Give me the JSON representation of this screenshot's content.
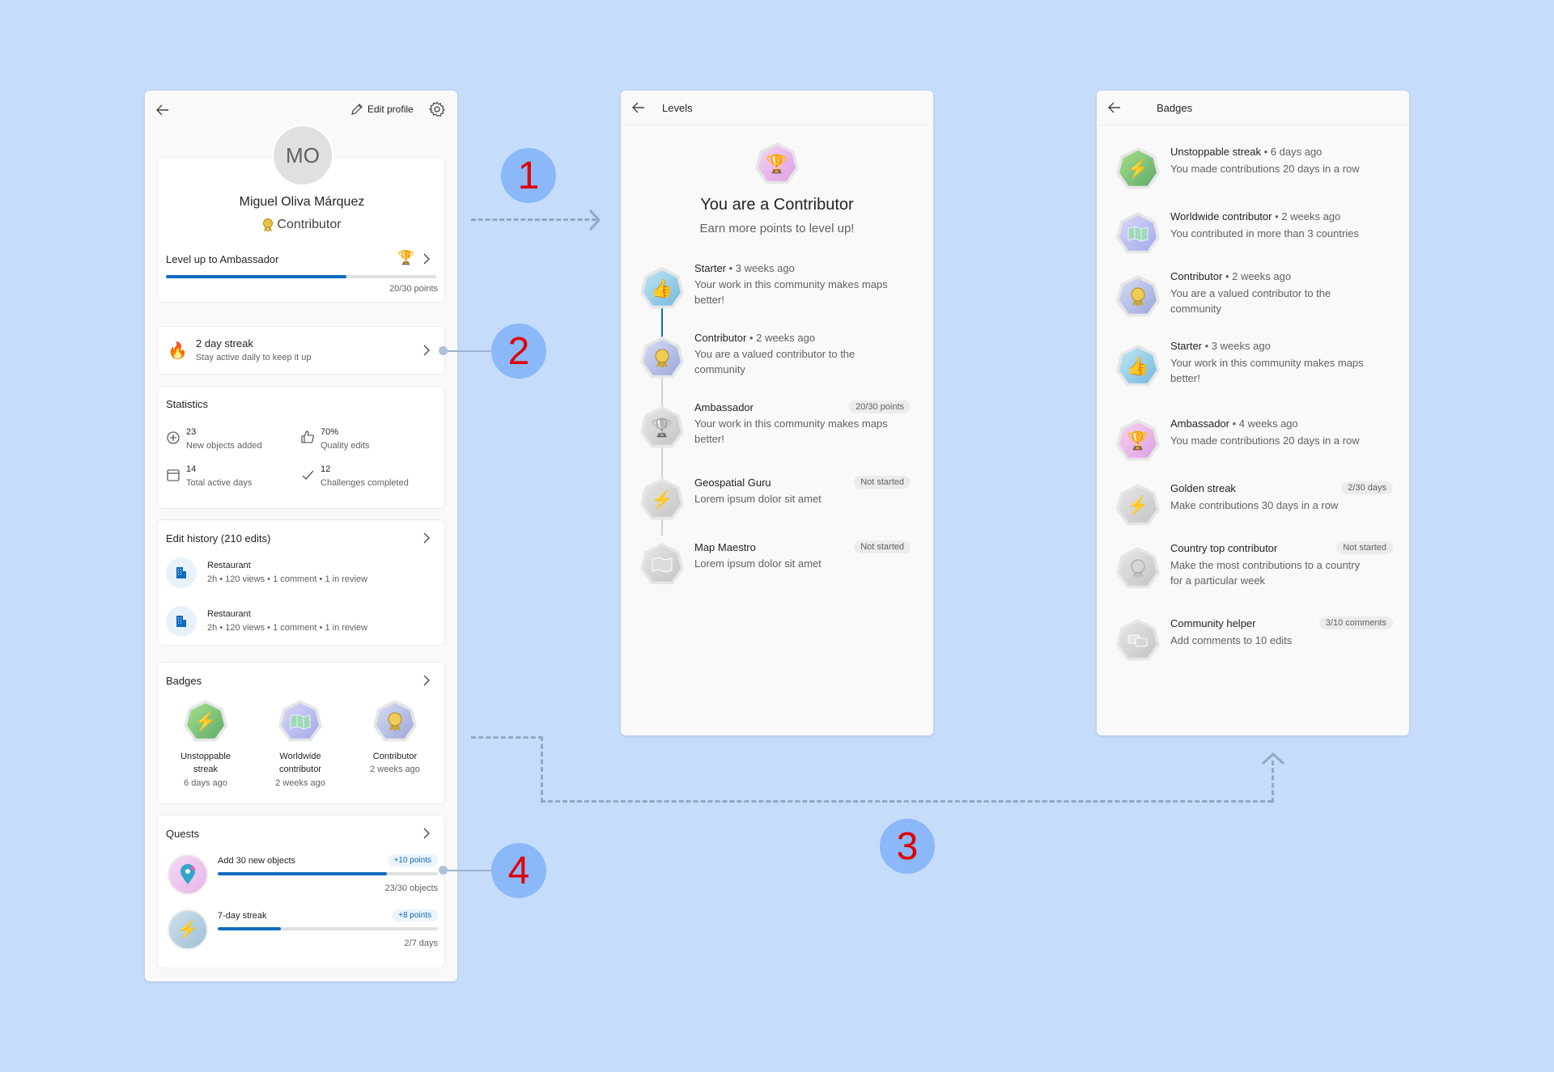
{
  "profile": {
    "edit_label": "Edit profile",
    "avatar_initials": "MO",
    "name": "Miguel Oliva Márquez",
    "level": "Contributor",
    "level_up_title": "Level up to Ambassador",
    "level_up_progress": 0.667,
    "level_up_points": "20/30 points",
    "streak_title": "2 day streak",
    "streak_sub": "Stay active daily to keep it up",
    "stats_title": "Statistics",
    "stats": [
      {
        "value": "23",
        "label": "New objects added",
        "icon": "plus-circle-icon"
      },
      {
        "value": "70%",
        "label": "Quality edits",
        "icon": "thumbs-up-icon"
      },
      {
        "value": "14",
        "label": "Total active days",
        "icon": "calendar-icon"
      },
      {
        "value": "12",
        "label": "Challenges completed",
        "icon": "checkmark-icon"
      }
    ],
    "history_title": "Edit history (210 edits)",
    "history": [
      {
        "title": "Restaurant",
        "meta": "2h • 120 views • 1 comment • 1 in review"
      },
      {
        "title": "Restaurant",
        "meta": "2h • 120 views • 1 comment • 1 in review"
      }
    ],
    "badges_title": "Badges",
    "badges": [
      {
        "name1": "Unstoppable",
        "name2": "streak",
        "time": "6 days ago"
      },
      {
        "name1": "Worldwide",
        "name2": "contributor",
        "time": "2 weeks ago"
      },
      {
        "name1": "Contributor",
        "name2": "",
        "time": "2 weeks ago"
      }
    ],
    "quests_title": "Quests",
    "quests": [
      {
        "title": "Add 30 new objects",
        "points": "+10 points",
        "progress_label": "23/30 objects",
        "progress": 0.767
      },
      {
        "title": "7-day streak",
        "points": "+8 points",
        "progress_label": "2/7 days",
        "progress": 0.286
      }
    ]
  },
  "levels": {
    "title": "Levels",
    "heading": "You are a Contributor",
    "subheading": "Earn more points to level up!",
    "items": [
      {
        "name": "Starter",
        "time": "• 3 weeks ago",
        "line1": "Your work in this community makes maps",
        "line2": "better!",
        "pill": ""
      },
      {
        "name": "Contributor",
        "time": "• 2 weeks ago",
        "line1": "You are a valued contributor to the",
        "line2": "community",
        "pill": ""
      },
      {
        "name": "Ambassador",
        "time": "",
        "line1": "Your work in this community makes maps",
        "line2": "better!",
        "pill": "20/30 points"
      },
      {
        "name": "Geospatial Guru",
        "time": "",
        "line1": "Lorem ipsum dolor sit amet",
        "line2": "",
        "pill": "Not started"
      },
      {
        "name": "Map Maestro",
        "time": "",
        "line1": "Lorem ipsum dolor sit amet",
        "line2": "",
        "pill": "Not started"
      }
    ]
  },
  "badges_page": {
    "title": "Badges",
    "items": [
      {
        "name": "Unstoppable streak",
        "time": "• 6 days ago",
        "line1": "You made contributions 20 days in a row",
        "line2": "",
        "pill": ""
      },
      {
        "name": "Worldwide contributor",
        "time": "• 2 weeks ago",
        "line1": "You contributed in more than 3 countries",
        "line2": "",
        "pill": ""
      },
      {
        "name": "Contributor",
        "time": "• 2 weeks ago",
        "line1": "You are a valued contributor to the",
        "line2": "community",
        "pill": ""
      },
      {
        "name": "Starter",
        "time": "• 3 weeks ago",
        "line1": "Your work in this community makes maps",
        "line2": "better!",
        "pill": ""
      },
      {
        "name": "Ambassador",
        "time": "• 4 weeks ago",
        "line1": "You made contributions 20 days in a row",
        "line2": "",
        "pill": ""
      },
      {
        "name": "Golden streak",
        "time": "",
        "line1": "Make contributions 30 days in a row",
        "line2": "",
        "pill": "2/30 days"
      },
      {
        "name": "Country top contributor",
        "time": "",
        "line1": "Make the most contributions to a country",
        "line2": "for a particular week",
        "pill": "Not started"
      },
      {
        "name": "Community helper",
        "time": "",
        "line1": "Add comments to 10 edits",
        "line2": "",
        "pill": "3/10 comments"
      }
    ]
  },
  "markers": [
    "1",
    "2",
    "3",
    "4"
  ],
  "colors": {
    "accent": "#0f6cbd",
    "background": "#c5dcfb",
    "marker": "#8ab8f9",
    "marker_text": "#e00000"
  }
}
